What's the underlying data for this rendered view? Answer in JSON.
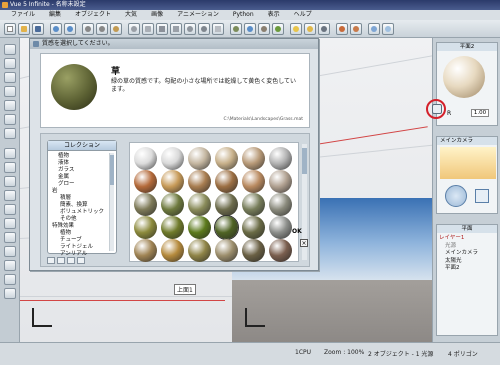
{
  "window": {
    "title": "Vue 5 Infinite - 名称未設定"
  },
  "menubar": [
    "ファイル",
    "編集",
    "オブジェクト",
    "大気",
    "画像",
    "アニメーション",
    "Python",
    "表示",
    "ヘルプ"
  ],
  "dialog": {
    "title": "質感を選択してください。",
    "material_name": "草",
    "material_desc": "緑の草の質感です。勾配の小さな場所では乾燥して黄色く変色しています。",
    "material_path": "C:\\Materials\\Landscapes\\Grass.mat",
    "collection_header": "コレクション",
    "tree": [
      "植物",
      "液体",
      "ガラス",
      "金属",
      "グロー",
      "岩",
      "積層",
      "簡素、換算",
      "ボリュメトリック",
      "その他",
      "特殊効果",
      "植物",
      "チューブ",
      "ライトジェル",
      "アンリアル"
    ],
    "ok_label": "OK",
    "close_label": "×",
    "swatch_colors": [
      "#dcdcdc",
      "#d9d9d9",
      "#c4b6a0",
      "#c7b08a",
      "#b89a78",
      "#b2b2b2",
      "#b46a3a",
      "#c79a58",
      "#a87d50",
      "#9c6f43",
      "#b98a60",
      "#b0a090",
      "#7e7a58",
      "#6e7a3e",
      "#8a8c5a",
      "#6d6c4c",
      "#777d5a",
      "#8a8a7c",
      "#8c8a3c",
      "#6f7a2a",
      "#5c7a1c",
      "#4f6324",
      "#6a6b45",
      "#8c8e8a",
      "#a08454",
      "#b58a3c",
      "#8f8447",
      "#9c8e6c",
      "#6a6044",
      "#7a5e4e"
    ]
  },
  "right_panel": {
    "preview_title": "平面2",
    "scale_label": "R",
    "scale_value": "1.00",
    "camera_title": "メインカメラ",
    "layers_title": "平面",
    "layers": [
      "レイヤー1",
      "光源",
      "メインカメラ",
      "太陽光",
      "平面2"
    ]
  },
  "viewport": {
    "label": "上面1"
  },
  "status": {
    "cpu": "1CPU",
    "zoom": "Zoom : 100%",
    "objects": "2 オブジェクト - 1 光源",
    "polygons": "4 ポリゴン"
  }
}
